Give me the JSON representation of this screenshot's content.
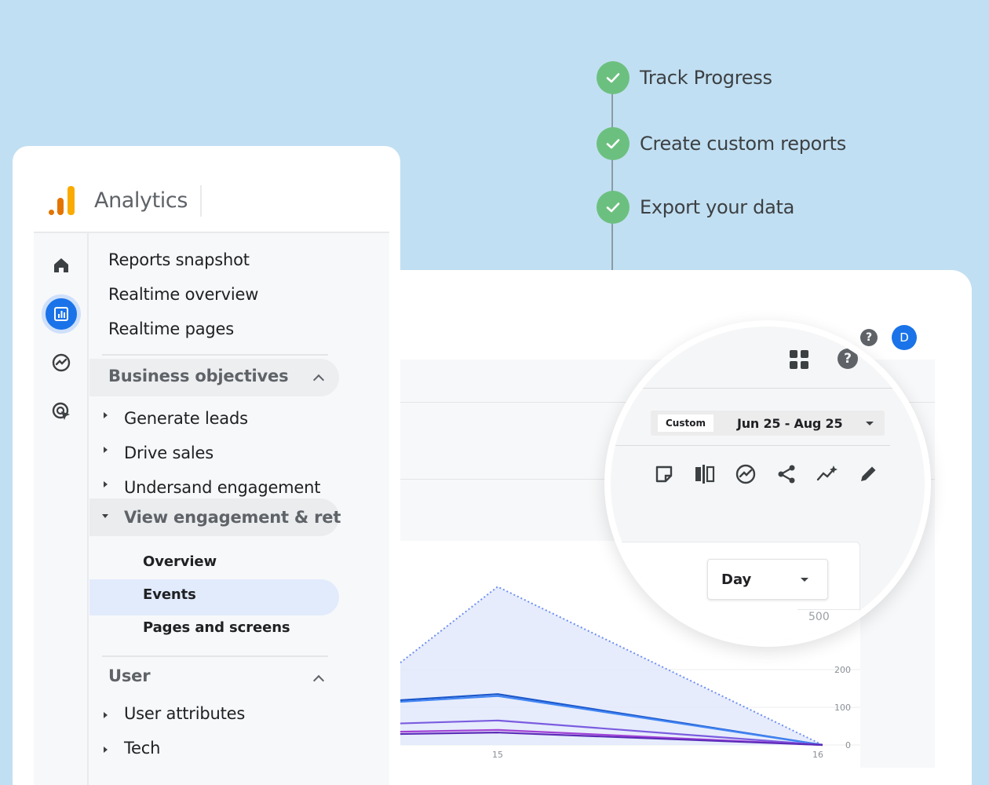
{
  "features": [
    {
      "label": "Track Progress"
    },
    {
      "label": "Create custom reports"
    },
    {
      "label": "Export your data"
    }
  ],
  "app": {
    "name": "Analytics"
  },
  "rail": {
    "home_icon": "home-icon",
    "reports_icon": "bar-chart-icon",
    "explore_icon": "explore-icon",
    "advertising_icon": "cursor-target-icon"
  },
  "nav": {
    "top_items": [
      "Reports snapshot",
      "Realtime overview",
      "Realtime pages"
    ],
    "business": {
      "title": "Business objectives",
      "items": [
        "Generate leads",
        "Drive sales",
        "Undersand engagement"
      ],
      "expanded_item": "View engagement & ret",
      "sub_items": [
        "Overview",
        "Events",
        "Pages and screens"
      ],
      "active_sub": "Events"
    },
    "user": {
      "title": "User",
      "items": [
        "User attributes",
        "Tech"
      ]
    }
  },
  "header": {
    "avatar_letter": "D",
    "help": "?"
  },
  "magnifier": {
    "date_chip": "Custom",
    "date_range": "Jun 25 - Aug 25",
    "granularity": "Day",
    "y_tick": "500"
  },
  "chart_data": {
    "type": "line",
    "x_ticks": [
      "15",
      "16"
    ],
    "y_ticks": [
      "0",
      "100",
      "200"
    ],
    "series": [
      {
        "values": [
          420,
          0
        ],
        "color": "#6f8ff2",
        "style": "dotted-area"
      },
      {
        "values": [
          135,
          0
        ],
        "color": "#1a56c9"
      },
      {
        "values": [
          130,
          0
        ],
        "color": "#4285f4"
      },
      {
        "values": [
          65,
          0
        ],
        "color": "#7b5ce0"
      },
      {
        "values": [
          40,
          0
        ],
        "color": "#a142d6"
      },
      {
        "values": [
          33,
          0
        ],
        "color": "#5b2bb8"
      }
    ],
    "ylim": [
      0,
      500
    ]
  },
  "colors": {
    "background": "#c1dff2",
    "check": "#6cc07f",
    "accent": "#1a73e8",
    "logo_dark": "#e37400",
    "logo_light": "#f9ab00"
  }
}
